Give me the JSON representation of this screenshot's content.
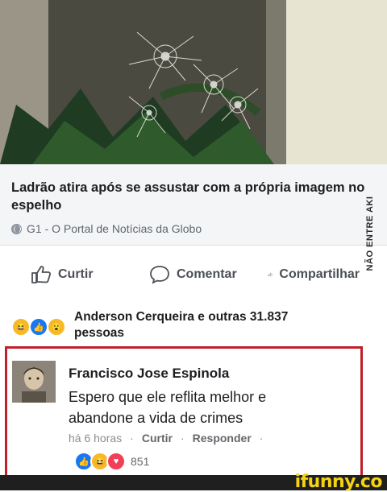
{
  "post": {
    "headline": "Ladrão atira após se assustar com a própria imagem no espelho",
    "source": "G1 - O Portal de Notícias da Globo"
  },
  "actions": {
    "like": "Curtir",
    "comment": "Comentar",
    "share": "Compartilhar"
  },
  "reactions": {
    "summary": "Anderson Cerqueira e outras 31.837 pessoas",
    "icons": [
      "laugh-reaction-icon",
      "like-reaction-icon",
      "wow-reaction-icon"
    ]
  },
  "comment": {
    "author": "Francisco Jose Espinola",
    "text": "Espero que ele reflita melhor e abandone a vida de crimes",
    "time": "há 6 horas",
    "like_label": "Curtir",
    "reply_label": "Responder",
    "reaction_count": "851",
    "reaction_icons": [
      "like-reaction-icon",
      "laugh-reaction-icon",
      "love-reaction-icon"
    ]
  },
  "watermark": {
    "side_text": "NÃO ENTRE AKI",
    "brand": "ifunny.co"
  },
  "colors": {
    "highlight_border": "#c0202a",
    "like_blue": "#1877f2",
    "brand_yellow": "#f5d312"
  }
}
